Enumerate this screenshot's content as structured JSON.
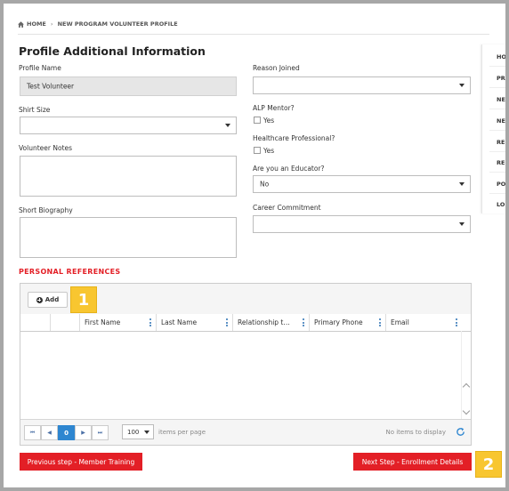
{
  "breadcrumb": {
    "home": "HOME",
    "separator": "›",
    "current": "NEW PROGRAM VOLUNTEER PROFILE"
  },
  "page_title": "Profile Additional Information",
  "left": {
    "profile_name_label": "Profile Name",
    "profile_name_value": "Test Volunteer",
    "shirt_size_label": "Shirt Size",
    "shirt_size_value": "",
    "volunteer_notes_label": "Volunteer Notes",
    "short_biography_label": "Short Biography"
  },
  "right": {
    "reason_joined_label": "Reason Joined",
    "reason_joined_value": "",
    "alp_mentor_label": "ALP Mentor?",
    "alp_mentor_option": "Yes",
    "healthcare_label": "Healthcare Professional?",
    "healthcare_option": "Yes",
    "educator_label": "Are you an Educator?",
    "educator_value": "No",
    "career_label": "Career Commitment",
    "career_value": ""
  },
  "references": {
    "title": "PERSONAL REFERENCES",
    "add_label": "Add",
    "columns": [
      "First Name",
      "Last Name",
      "Relationship t…",
      "Primary Phone",
      "Email"
    ],
    "pager": {
      "first": "⏮",
      "prev": "◀",
      "current_page": "0",
      "next": "▶",
      "last": "⏭",
      "page_size": "100",
      "items_per_page": "items per page",
      "no_items": "No items to display"
    }
  },
  "buttons": {
    "previous": "Previous step - Member Training",
    "next": "Next Step - Enrollment Details"
  },
  "callouts": {
    "one": "1",
    "two": "2"
  },
  "side_panel": [
    "HO",
    "PR",
    "NE",
    "NE",
    "RE",
    "RE",
    "PO",
    "LO"
  ],
  "colors": {
    "accent_red": "#e31f26",
    "callout_yellow": "#f8c630",
    "pager_blue": "#2e86d0"
  }
}
